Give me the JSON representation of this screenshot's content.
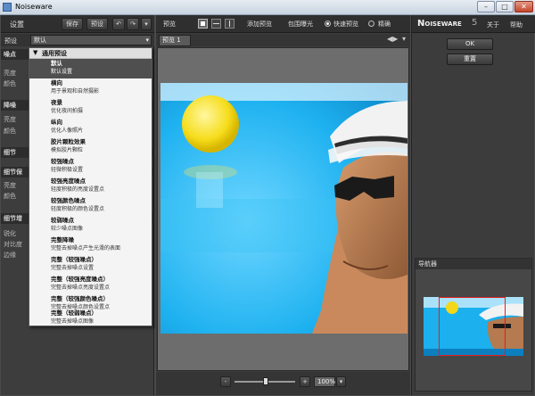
{
  "window": {
    "title": "Noiseware",
    "min_glyph": "–",
    "max_glyph": "□",
    "close_glyph": "✕"
  },
  "left": {
    "header": {
      "title": "设置",
      "save": "保存",
      "preset": "预设",
      "undo_glyph": "↶",
      "redo_glyph": "↷",
      "menu_glyph": "▾"
    },
    "preset_label": "预设",
    "preset_value": "默认",
    "sections": [
      {
        "title": "噪点",
        "labels": [
          "亮度",
          "颜色"
        ]
      },
      {
        "title": "降噪",
        "labels": [
          "亮度",
          "颜色"
        ]
      },
      {
        "title": "细节",
        "labels": []
      },
      {
        "title": "细节保",
        "labels": [
          "亮度",
          "颜色"
        ]
      },
      {
        "title": "细节增",
        "labels": [
          "锐化",
          "对比度",
          "边缘"
        ]
      }
    ]
  },
  "dropdown": {
    "group_label": "通用预设",
    "items": [
      {
        "name": "默认",
        "desc": "默认设置"
      },
      {
        "name": "横向",
        "desc": "用于景观和自然摄影"
      },
      {
        "name": "夜景",
        "desc": "优化夜间拍摄"
      },
      {
        "name": "纵向",
        "desc": "优化人像照片"
      },
      {
        "name": "胶片颗粒效果",
        "desc": "模拟胶片颗粒"
      },
      {
        "name": "较强噪点",
        "desc": "轻微积极设置"
      },
      {
        "name": "较强亮度噪点",
        "desc": "轻度积极的亮度设置点"
      },
      {
        "name": "较强颜色噪点",
        "desc": "轻度积极的颜色设置点"
      },
      {
        "name": "较弱噪点",
        "desc": "较少噪点图像"
      },
      {
        "name": "完整降噪",
        "desc": "完整去掉噪点产生光滑的表面"
      },
      {
        "name": "完整（较强噪点）",
        "desc": "完整去掉噪点设置"
      },
      {
        "name": "完整（较强亮度噪点）",
        "desc": "完整去掉噪点亮度设置点"
      },
      {
        "name": "完整（较强颜色噪点）",
        "desc": "完整去掉噪点颜色设置点"
      },
      {
        "name": "完整（较弱噪点）",
        "desc": "完整去掉噪点图像"
      }
    ]
  },
  "center": {
    "toolbar": {
      "title": "预览",
      "add_preview": "添加预览",
      "clipping": "包围曝光",
      "fast_preview": "快速预览",
      "accurate": "精确"
    },
    "tab_label": "预览 1",
    "zoom": {
      "minus": "-",
      "plus": "+",
      "value": "100%",
      "dropdown_glyph": "▾"
    }
  },
  "right": {
    "brand_main": "Noiseware",
    "brand_version": "5",
    "about": "关于",
    "help": "帮助",
    "ok": "OK",
    "reset": "重置",
    "navigator": "导航器"
  }
}
